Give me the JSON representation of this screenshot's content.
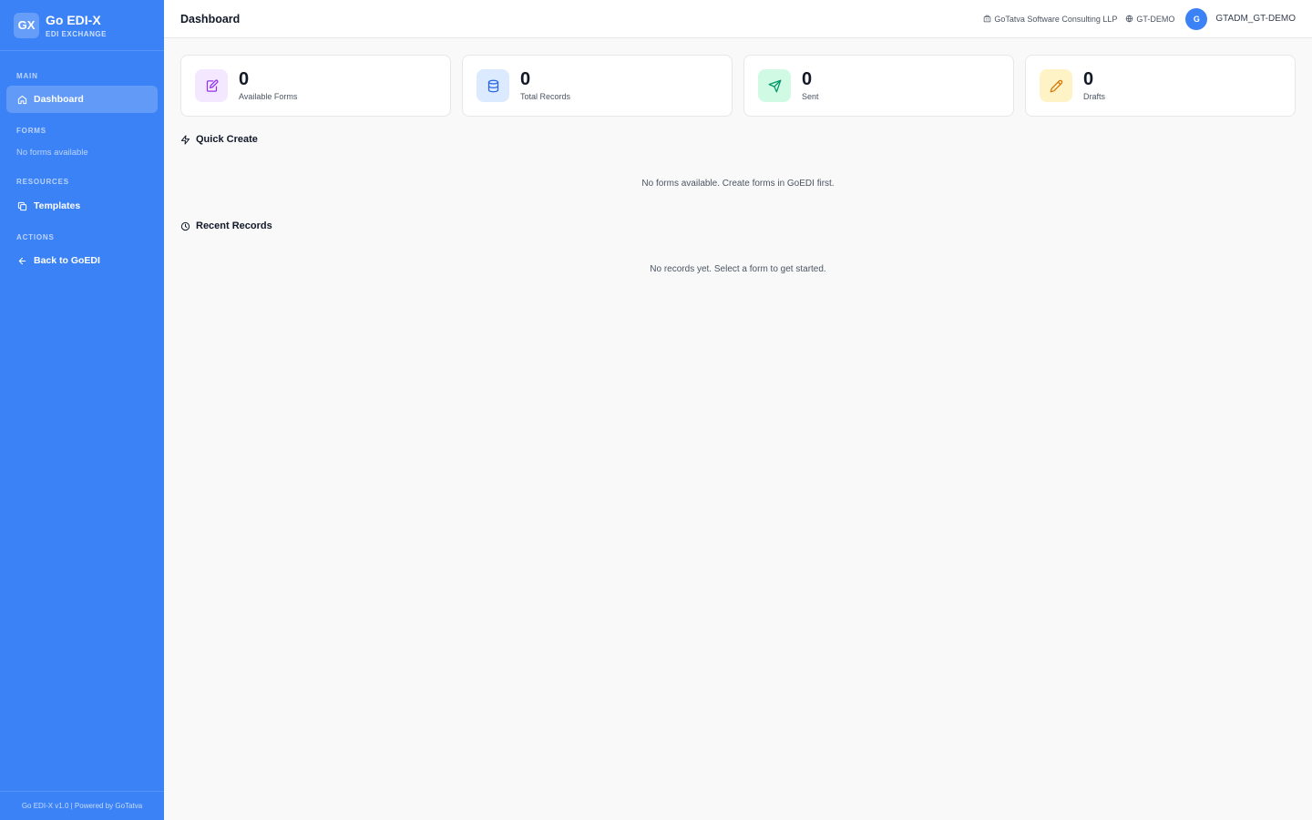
{
  "sidebar": {
    "logo_text": "GX",
    "brand_name": "Go EDI-X",
    "brand_sub": "EDI EXCHANGE",
    "main_label": "MAIN",
    "dashboard_label": "Dashboard",
    "forms_label": "FORMS",
    "forms_empty": "No forms available",
    "resources_label": "RESOURCES",
    "templates_label": "Templates",
    "actions_label": "ACTIONS",
    "back_label": "Back to GoEDI",
    "footer": "Go EDI-X v1.0 | Powered by GoTatva"
  },
  "header": {
    "title": "Dashboard",
    "company": "GoTatva Software Consulting LLP",
    "tenant": "GT-DEMO",
    "avatar_initial": "G",
    "username": "GTADM_GT-DEMO"
  },
  "stats": [
    {
      "value": "0",
      "label": "Available Forms",
      "icon": "edit-document-icon",
      "bg": "#f3e8ff",
      "fg": "#9333ea"
    },
    {
      "value": "0",
      "label": "Total Records",
      "icon": "database-icon",
      "bg": "#dbeafe",
      "fg": "#2563eb"
    },
    {
      "value": "0",
      "label": "Sent",
      "icon": "send-icon",
      "bg": "#d1fae5",
      "fg": "#059669"
    },
    {
      "value": "0",
      "label": "Drafts",
      "icon": "pencil-icon",
      "bg": "#fef3c7",
      "fg": "#d97706"
    }
  ],
  "quick_create": {
    "title": "Quick Create",
    "empty": "No forms available. Create forms in GoEDI first."
  },
  "recent_records": {
    "title": "Recent Records",
    "empty": "No records yet. Select a form to get started."
  }
}
